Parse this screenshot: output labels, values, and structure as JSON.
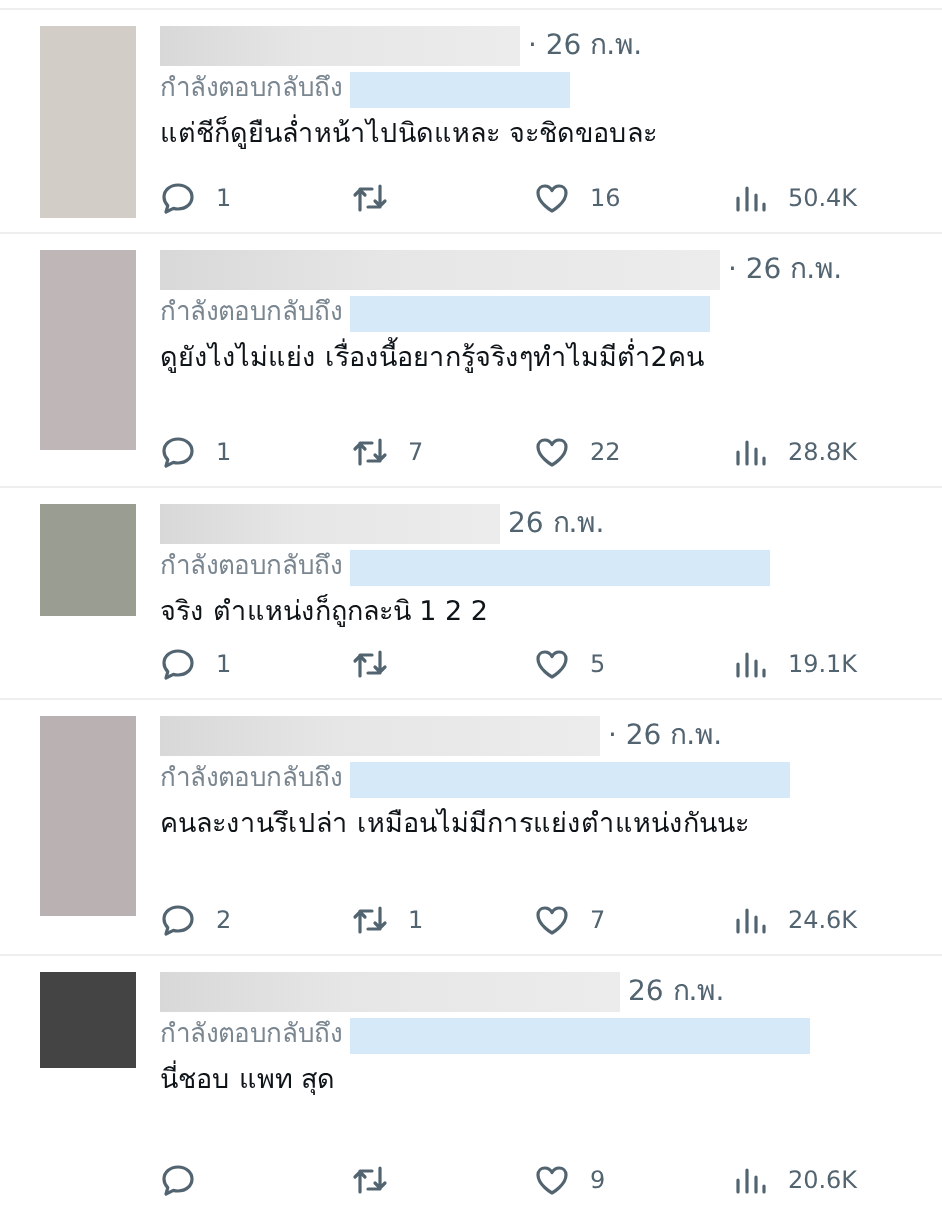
{
  "replies": [
    {
      "color": "#d3cdc8",
      "date": "· 26 ก.พ.",
      "reply_to": "กำลังตอบกลับถึง",
      "text": "แต่ชีก็ดูยืนล่ำหน้าไปนิดแหละ จะชิดขอบละ",
      "replies": "1",
      "likes": "16",
      "views": "50.4K"
    },
    {
      "color": "#bfb7b7",
      "date": "· 26 ก.พ.",
      "reply_to": "กำลังตอบกลับถึง",
      "text": "ดูยังไงไม่แย่ง เรื่องนี้อยากรู้จริงๆทำไมมีต่ำ2คน",
      "replies": "1",
      "retweets": "7",
      "likes": "22",
      "views": "28.8K"
    },
    {
      "color": "#9a9e92",
      "date": "26 ก.พ.",
      "reply_to": "กำลังตอบกลับถึง",
      "text": "จริง ตำแหน่งก็ถูกละนิ 1 2 2",
      "replies": "1",
      "likes": "5",
      "views": "19.1K"
    },
    {
      "color": "#b9b1b2",
      "date": "· 26 ก.พ.",
      "reply_to": "กำลังตอบกลับถึง",
      "text": "คนละงานรึเปล่า เหมือนไม่มีการแย่งตำแหน่งกันนะ",
      "replies": "2",
      "retweets": "1",
      "likes": "7",
      "views": "24.6K"
    },
    {
      "color": "#444444",
      "date": "26 ก.พ.",
      "reply_to": "กำลังตอบกลับถึง",
      "text": "นี่ชอบ แพท สุด",
      "likes": "9",
      "views": "20.6K"
    }
  ]
}
